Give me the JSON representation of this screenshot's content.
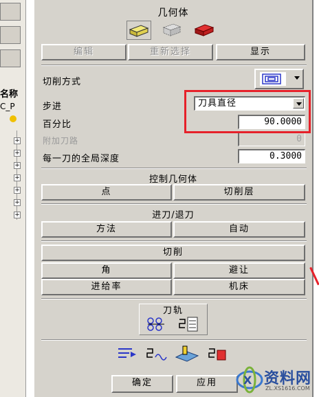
{
  "tree": {
    "header": "名称",
    "sub": "C_P"
  },
  "dialog": {
    "title": "几何体",
    "geometry_icons": [
      "part-geometry-icon",
      "blank-geometry-icon",
      "check-geometry-icon"
    ],
    "geometry_buttons": {
      "edit": "编辑",
      "reselect": "重新选择",
      "display": "显示"
    },
    "cut_method_label": "切削方式",
    "step_label": "步进",
    "step_value": "刀具直径",
    "percent_label": "百分比",
    "percent_value": "90.0000",
    "extra_passes_label": "附加刀路",
    "extra_passes_value": "0",
    "depth_label": "每一刀的全局深度",
    "depth_value": "0.3000",
    "control_geometry_title": "控制几何体",
    "point_button": "点",
    "cut_levels_button": "切削层",
    "engage_retract_title": "进刀/退刀",
    "method_button": "方法",
    "auto_button": "自动",
    "cutting_button": "切削",
    "corner_button": "角",
    "avoidance_button": "避让",
    "feedrate_button": "进给率",
    "machine_button": "机床",
    "toolpath_title": "刀轨",
    "ok_button": "确定",
    "apply_button": "应用"
  },
  "watermark": {
    "text": "资料网",
    "url": "ZL.XS1616.COM"
  },
  "colors": {
    "dialog_bg": "#d6d3cc",
    "highlight": "#e6212a"
  }
}
